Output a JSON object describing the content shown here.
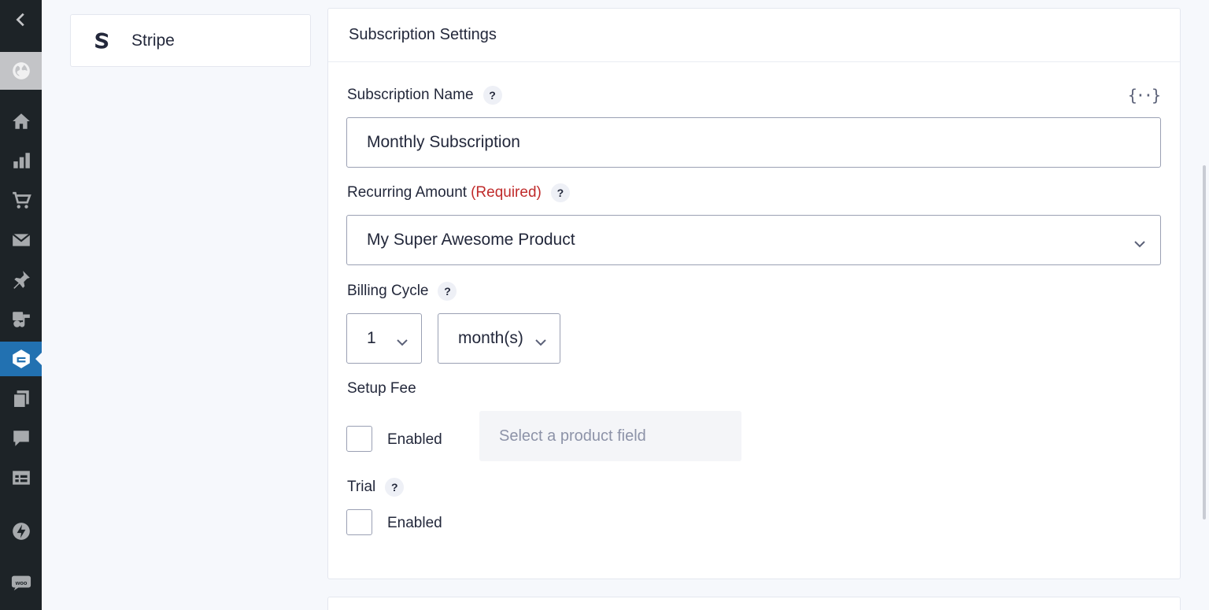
{
  "sidebar": {
    "items": [
      {
        "icon": "chevron-left-icon"
      },
      {
        "icon": "globe-icon"
      },
      {
        "icon": "home-icon"
      },
      {
        "icon": "bar-chart-icon"
      },
      {
        "icon": "cart-icon"
      },
      {
        "icon": "mail-icon"
      },
      {
        "icon": "pin-icon"
      },
      {
        "icon": "media-icon"
      },
      {
        "icon": "forms-icon"
      },
      {
        "icon": "pages-icon"
      },
      {
        "icon": "comment-icon"
      },
      {
        "icon": "table-icon"
      },
      {
        "icon": "bolt-icon"
      },
      {
        "icon": "woo-icon"
      }
    ],
    "active_item": "forms-icon",
    "woo_text": "woo"
  },
  "feed_list": {
    "items": [
      {
        "label": "Stripe",
        "icon": "stripe-logo"
      }
    ]
  },
  "settings": {
    "title": "Subscription Settings",
    "merge_tag_symbol": "{··}",
    "subscription_name": {
      "label": "Subscription Name",
      "help": "?",
      "value": "Monthly Subscription"
    },
    "recurring_amount": {
      "label": "Recurring Amount",
      "required": "(Required)",
      "help": "?",
      "value": "My Super Awesome Product"
    },
    "billing_cycle": {
      "label": "Billing Cycle",
      "help": "?",
      "number": "1",
      "unit": "month(s)"
    },
    "setup_fee": {
      "label": "Setup Fee",
      "checkbox_label": "Enabled",
      "checked": false,
      "product_placeholder": "Select a product field"
    },
    "trial": {
      "label": "Trial",
      "help": "?",
      "checkbox_label": "Enabled",
      "checked": false
    }
  }
}
